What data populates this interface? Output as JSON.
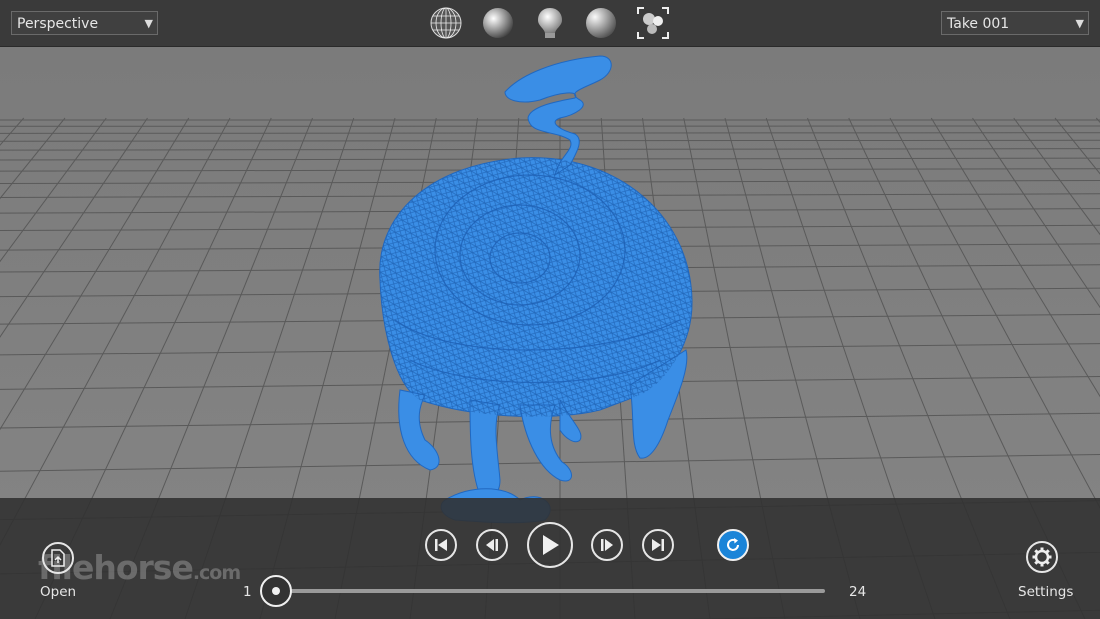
{
  "top": {
    "view_select": "Perspective",
    "take_select": "Take 001",
    "modes": [
      "wireframe-sphere-icon",
      "shaded-sphere-icon",
      "light-bulb-icon",
      "smooth-sphere-icon",
      "frame-selection-icon"
    ]
  },
  "bottom": {
    "open_label": "Open",
    "settings_label": "Settings",
    "frame_start": "1",
    "frame_end": "24",
    "timeline_progress": 0.0
  },
  "watermark": {
    "main": "filehorse",
    "suffix": ".com"
  },
  "colors": {
    "model_blue": "#3a8ee6",
    "loop_blue": "#1a84d8"
  }
}
